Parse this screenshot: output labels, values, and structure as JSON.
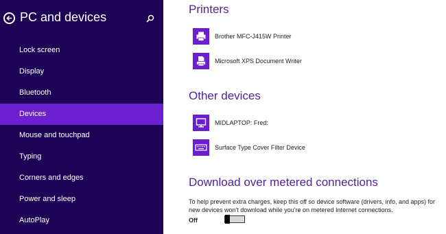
{
  "sidebar": {
    "title": "PC and devices",
    "items": [
      {
        "label": "Lock screen",
        "active": false
      },
      {
        "label": "Display",
        "active": false
      },
      {
        "label": "Bluetooth",
        "active": false
      },
      {
        "label": "Devices",
        "active": true
      },
      {
        "label": "Mouse and touchpad",
        "active": false
      },
      {
        "label": "Typing",
        "active": false
      },
      {
        "label": "Corners and edges",
        "active": false
      },
      {
        "label": "Power and sleep",
        "active": false
      },
      {
        "label": "AutoPlay",
        "active": false
      }
    ]
  },
  "main": {
    "printers": {
      "title": "Printers",
      "devices": [
        {
          "name": "Brother MFC-J415W Printer",
          "icon": "printer-icon"
        },
        {
          "name": "Microsoft XPS Document Writer",
          "icon": "document-printer-icon"
        }
      ]
    },
    "other": {
      "title": "Other devices",
      "devices": [
        {
          "name": "MIDLAPTOP: Fred:",
          "icon": "monitor-icon"
        },
        {
          "name": "Surface Type Cover Filter Device",
          "icon": "keyboard-icon"
        }
      ]
    },
    "metered": {
      "title": "Download over metered connections",
      "description": "To help prevent extra charges, keep this off so device software (drivers, info, and apps) for new devices won't download while you're on metered Internet connections.",
      "toggle_label": "Off",
      "toggle_on": false
    }
  },
  "colors": {
    "sidebar_bg": "#1c0356",
    "accent": "#6b1fce",
    "heading": "#52229e"
  }
}
